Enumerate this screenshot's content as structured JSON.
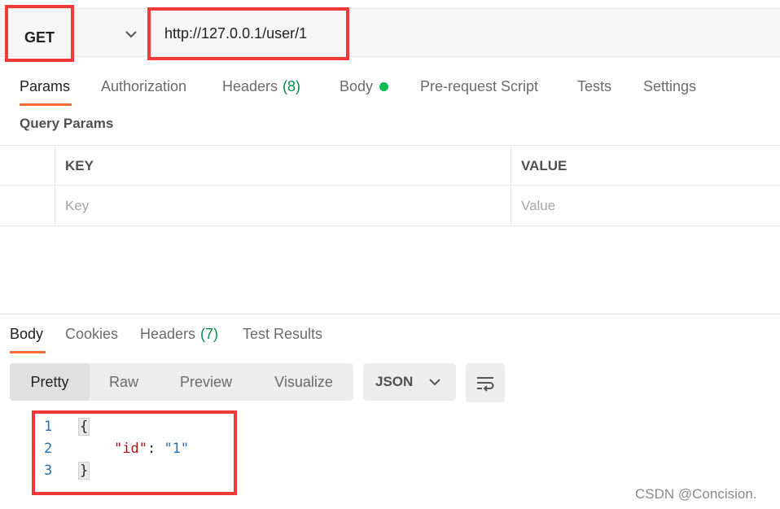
{
  "request": {
    "method": "GET",
    "url": "http://127.0.0.1/user/1"
  },
  "request_tabs": [
    {
      "label": "Params",
      "count": ""
    },
    {
      "label": "Authorization",
      "count": ""
    },
    {
      "label": "Headers",
      "count": "(8)"
    },
    {
      "label": "Body",
      "count": ""
    },
    {
      "label": "Pre-request Script",
      "count": ""
    },
    {
      "label": "Tests",
      "count": ""
    },
    {
      "label": "Settings",
      "count": ""
    }
  ],
  "query_params": {
    "title": "Query Params",
    "key_header": "KEY",
    "value_header": "VALUE",
    "key_placeholder": "Key",
    "value_placeholder": "Value"
  },
  "response_tabs": [
    {
      "label": "Body",
      "count": ""
    },
    {
      "label": "Cookies",
      "count": ""
    },
    {
      "label": "Headers",
      "count": "(7)"
    },
    {
      "label": "Test Results",
      "count": ""
    }
  ],
  "view_modes": [
    "Pretty",
    "Raw",
    "Preview",
    "Visualize"
  ],
  "format": "JSON",
  "code": {
    "line_numbers": [
      "1",
      "2",
      "3"
    ],
    "open_brace": "{",
    "key": "\"id\"",
    "colon": ": ",
    "value": "\"1\"",
    "close_brace": "}"
  },
  "watermark": "CSDN @Concision.",
  "colors": {
    "accent": "#ff6c37",
    "highlight_box": "#f03a3a",
    "count_green": "#0a8a4a",
    "status_dot": "#0cbb52"
  }
}
